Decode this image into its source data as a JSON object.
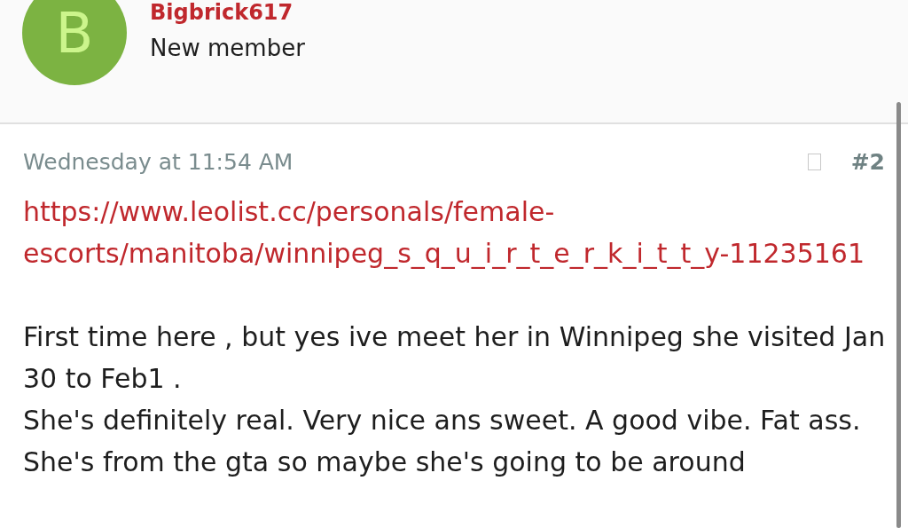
{
  "author": {
    "avatar_letter": "B",
    "username": "Bigbrick617",
    "role": "New member"
  },
  "post": {
    "date": "Wednesday at 11:54 AM",
    "number": "#2",
    "link": "https://www.leolist.cc/personals/female-escorts/manitoba/winnipeg_s_q_u_i_r_t_e_r_k_i_t_t_y-11235161",
    "paragraphs": [
      "First time here , but yes ive meet her in Winnipeg she visited Jan 30 to Feb1 .",
      "She's definitely real. Very nice ans sweet. A good vibe. Fat ass. She's from the gta so maybe she's going to be around"
    ]
  }
}
